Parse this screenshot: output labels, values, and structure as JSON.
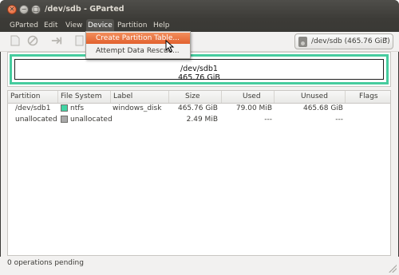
{
  "window": {
    "title": "/dev/sdb - GParted"
  },
  "menubar": {
    "items": [
      "GParted",
      "Edit",
      "View",
      "Device",
      "Partition",
      "Help"
    ],
    "active": "Device"
  },
  "device_menu": {
    "items": [
      "Create Partition Table...",
      "Attempt Data Rescue..."
    ],
    "highlighted": "Create Partition Table..."
  },
  "toolbar": {
    "icons": [
      "new-icon",
      "delete-icon",
      "resize-move-icon",
      "copy-icon"
    ]
  },
  "device_selector": {
    "label": "/dev/sdb  (465.76 GiB)",
    "icon": "hard-disk-icon"
  },
  "disk_map": {
    "partition": "/dev/sdb1",
    "size": "465.76 GiB",
    "color": "#46cc9e"
  },
  "table": {
    "columns": [
      "Partition",
      "File System",
      "Label",
      "Size",
      "Used",
      "Unused",
      "Flags"
    ],
    "rows": [
      {
        "partition": "/dev/sdb1",
        "filesystem": "ntfs",
        "fs_color": "#42d4a4",
        "label": "windows_disk",
        "size": "465.76 GiB",
        "used": "79.00 MiB",
        "unused": "465.68 GiB",
        "flags": ""
      },
      {
        "partition": "unallocated",
        "filesystem": "unallocated",
        "fs_color": "#a9a9a9",
        "label": "",
        "size": "2.49 MiB",
        "used": "---",
        "unused": "---",
        "flags": ""
      }
    ]
  },
  "statusbar": {
    "text": "0 operations pending"
  }
}
